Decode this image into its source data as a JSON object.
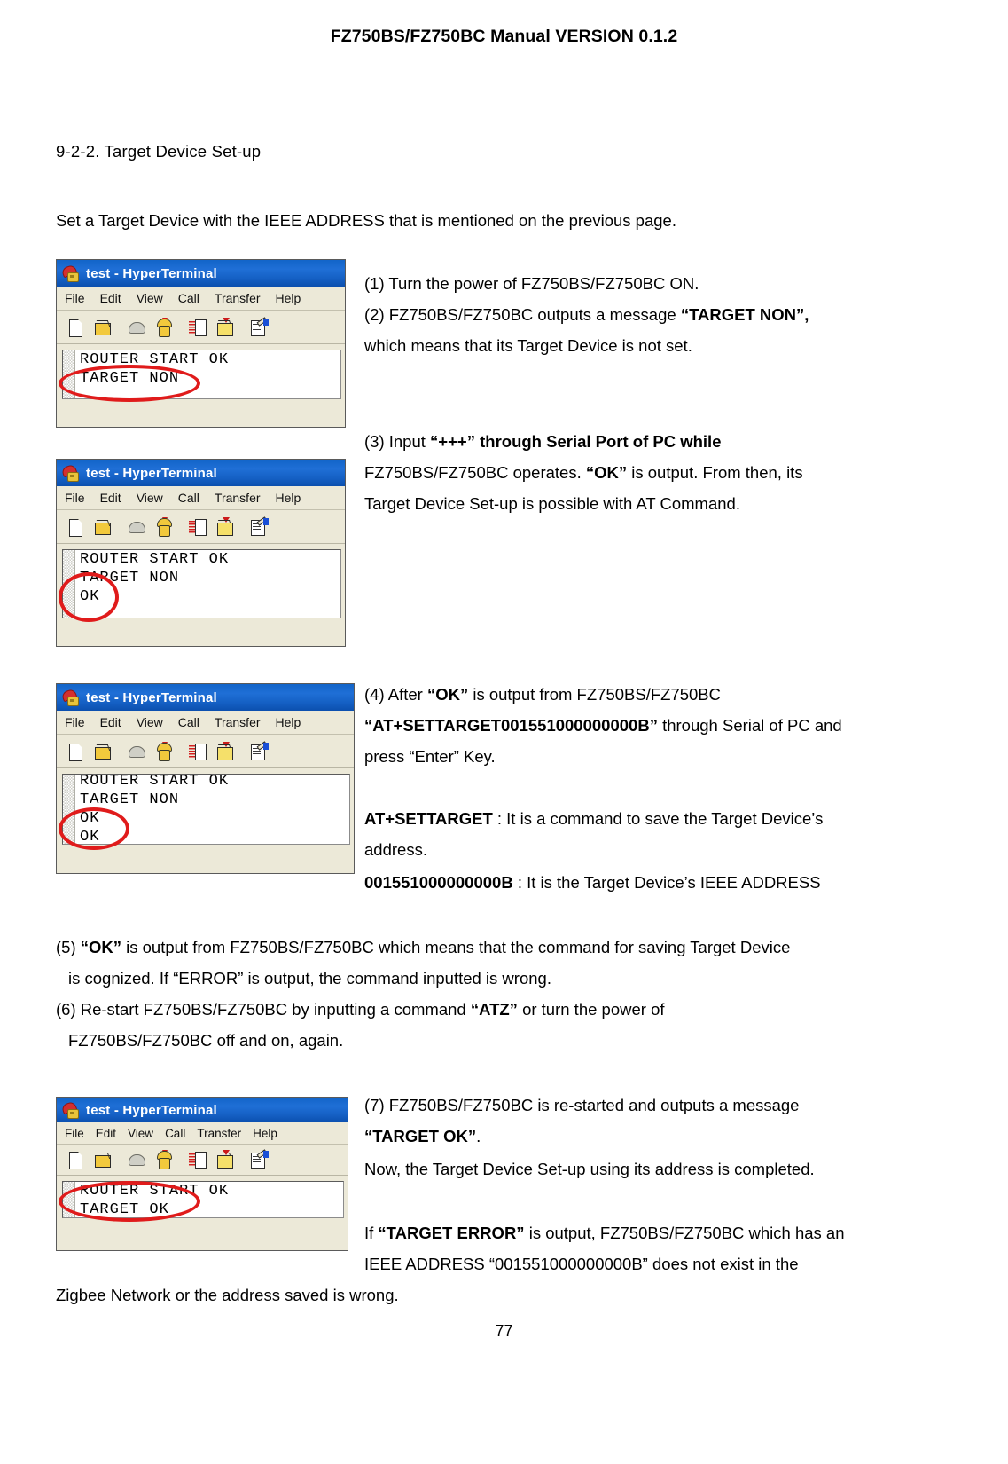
{
  "header": {
    "title": "FZ750BS/FZ750BC Manual VERSION 0.1.2"
  },
  "section": {
    "heading": "9-2-2. Target Device Set-up",
    "intro": "Set a Target Device with the IEEE ADDRESS that is mentioned on the previous page."
  },
  "page_number": "77",
  "terminal_common": {
    "window_title": "test - HyperTerminal",
    "menu": [
      "File",
      "Edit",
      "View",
      "Call",
      "Transfer",
      "Help"
    ],
    "toolbar_icons": [
      "new-connection-icon",
      "open-folder-icon",
      "disconnect-phone-icon",
      "connect-phone-icon",
      "send-file-icon",
      "receive-file-icon",
      "properties-icon"
    ]
  },
  "terminals": [
    {
      "id": "terminal-1",
      "lines": [
        "ROUTER START OK",
        "TARGET NON"
      ],
      "annotation": "red-ellipse-target-non"
    },
    {
      "id": "terminal-2",
      "lines": [
        "ROUTER START OK",
        "TARGET NON",
        "OK"
      ],
      "annotation": "red-ellipse-ok"
    },
    {
      "id": "terminal-3",
      "lines": [
        "ROUTER START OK",
        "TARGET NON",
        "OK",
        "OK"
      ],
      "annotation": "red-ellipse-second-ok"
    },
    {
      "id": "terminal-4",
      "lines": [
        "ROUTER START OK",
        "TARGET OK"
      ],
      "annotation": "red-ellipse-target-ok"
    }
  ],
  "body": {
    "step1": "(1) Turn the power of FZ750BS/FZ750BC ON.",
    "step2_a": "(2)  FZ750BS/FZ750BC  outputs  a  message  ",
    "step2_b": "“TARGET NON”,",
    "step2_c": "which means that its Target Device is not set.",
    "step3_a": "(3)    Input    ",
    "step3_b": "“+++”",
    "step3_c": "    through    Serial    Port    of    PC    while",
    "step3_d": "FZ750BS/FZ750BC  operates.  ",
    "step3_e": "“OK”",
    "step3_f": "  is  output.  From  then,  its",
    "step3_g": "Target Device Set-up is possible with AT Command.",
    "step4_a": "(4)    After    ",
    "step4_b": "“OK”",
    "step4_c": "    is    output    from    FZ750BS/FZ750BC",
    "step4_d": "“AT+SETTARGET001551000000000B”",
    "step4_e": " through  Serial  of  PC  and",
    "step4_f": "press “Enter” Key.",
    "note1_cmd": "AT+SETTARGET",
    "note1_text": " : It  is  a  command  to  save  the  Target  Device’s",
    "note1_cont": "address.",
    "note2_addr": "001551000000000B",
    "note2_text": " : It is the Target Device’s IEEE ADDRESS",
    "step5_a": "(5) ",
    "step5_b": "“OK”",
    "step5_c": " is output from FZ750BS/FZ750BC which means that the command for saving Target Device",
    "step5_d": "is cognized. If “ERROR” is output, the command inputted is wrong.",
    "step6_a": "(6)   Re-start   FZ750BS/FZ750BC   by   inputting   a   command   ",
    "step6_b": "“ATZ”",
    "step6_c": "   or   turn   the   power   of",
    "step6_d": "FZ750BS/FZ750BC off and on, again.",
    "step7_a": "(7)  FZ750BS/FZ750BC  is  re-started  and  outputs  a  message",
    "step7_b": "“TARGET OK”",
    "step7_c": ".",
    "step7_d": "Now, the Target Device Set-up using its address is completed.",
    "step8_a": "If ",
    "step8_b": "“TARGET ERROR”",
    "step8_c": " is output, FZ750BS/FZ750BC which has an",
    "step8_d": "IEEE  ADDRESS  “001551000000000B”  does  not  exist  in  the",
    "step8_e": "Zigbee Network or the address saved is wrong."
  }
}
